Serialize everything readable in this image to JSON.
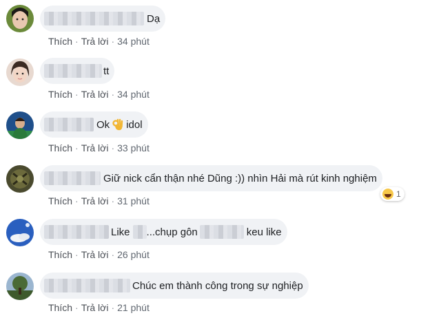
{
  "actions": {
    "like": "Thích",
    "reply": "Trả lời",
    "sep": "·"
  },
  "comments": [
    {
      "text": "Dạ",
      "time": "34 phút"
    },
    {
      "text": "tt",
      "time": "34 phút"
    },
    {
      "text": "Ok",
      "text2": "idol",
      "time": "33 phút"
    },
    {
      "text": "Giữ nick cẩn thận nhé Dũng :)) nhìn Hải mà rút kinh nghiệm",
      "time": "31 phút",
      "reaction": {
        "icon": "laugh-emoji",
        "count": "1"
      }
    },
    {
      "text": "Like",
      "text2": "...chụp gôn",
      "text3": "keu like",
      "time": "26 phút"
    },
    {
      "text": "Chúc em thành công trong sự nghiệp",
      "time": "21 phút"
    }
  ],
  "icons": {
    "ok": "ok-hand-emoji"
  }
}
